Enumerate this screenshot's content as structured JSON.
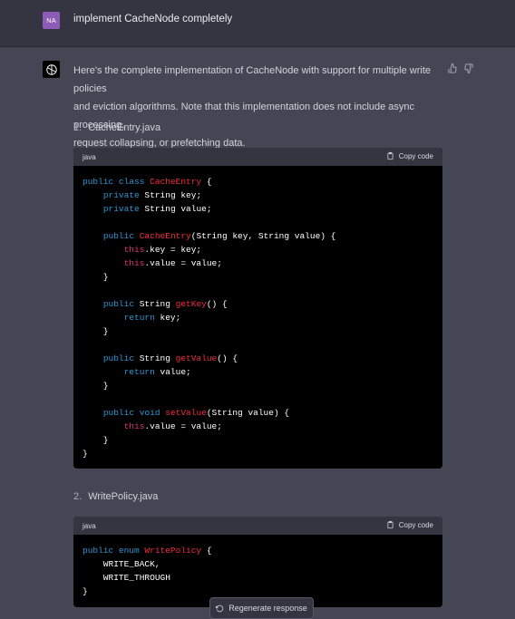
{
  "user": {
    "initials": "NA",
    "message": "implement CacheNode completely"
  },
  "assistant": {
    "intro_line1": "Here's the complete implementation of CacheNode with support for multiple write policies",
    "intro_line2": "and eviction algorithms. Note that this implementation does not include async processing,",
    "intro_line3": "request collapsing, or prefetching data."
  },
  "files": [
    {
      "number": "1.",
      "name": "CacheEntry.java",
      "lang": "java",
      "copy_label": "Copy code"
    },
    {
      "number": "2.",
      "name": "WritePolicy.java",
      "lang": "java",
      "copy_label": "Copy code"
    }
  ],
  "code1": [
    "public class CacheEntry {",
    "    private String key;",
    "    private String value;",
    "",
    "    public CacheEntry(String key, String value) {",
    "        this.key = key;",
    "        this.value = value;",
    "    }",
    "",
    "    public String getKey() {",
    "        return key;",
    "    }",
    "",
    "    public String getValue() {",
    "        return value;",
    "    }",
    "",
    "    public void setValue(String value) {",
    "        this.value = value;",
    "    }",
    "}"
  ],
  "code2": [
    "public enum WritePolicy {",
    "    WRITE_BACK,",
    "    WRITE_THROUGH",
    "}"
  ],
  "regenerate_label": "Regenerate response",
  "colors": {
    "keyword": "#2e95d3",
    "function_name": "#f22c3d",
    "this_keyword": "#df3079",
    "avatar_bg": "#8e5bb6"
  }
}
